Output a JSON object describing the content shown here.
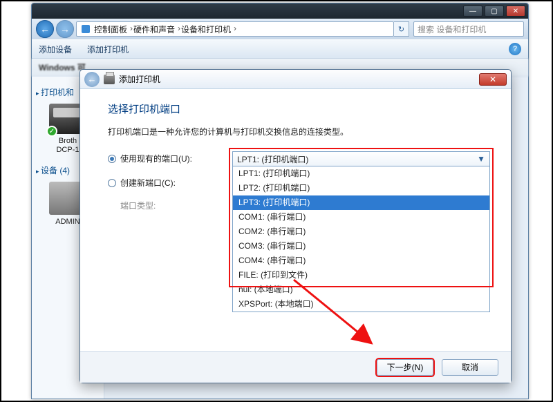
{
  "explorer": {
    "breadcrumb": [
      "控制面板",
      "硬件和声音",
      "设备和打印机"
    ],
    "search_placeholder": "搜索 设备和打印机",
    "toolbar": {
      "add_device": "添加设备",
      "add_printer": "添加打印机"
    },
    "info_prefix": "Windows 可",
    "sidebar": {
      "cat_printers": "打印机和",
      "device1_line1": "Broth",
      "device1_line2": "DCP-1",
      "cat_devices": "设备 (4)",
      "device2": "ADMIN"
    }
  },
  "dialog": {
    "title": "添加打印机",
    "heading": "选择打印机端口",
    "description": "打印机端口是一种允许您的计算机与打印机交换信息的连接类型。",
    "opt_use_existing": "使用现有的端口(U):",
    "opt_create_new": "创建新端口(C):",
    "port_type_label": "端口类型:",
    "combo_selected": "LPT1: (打印机端口)",
    "port_options": [
      "LPT1: (打印机端口)",
      "LPT2: (打印机端口)",
      "LPT3: (打印机端口)",
      "COM1: (串行端口)",
      "COM2: (串行端口)",
      "COM3: (串行端口)",
      "COM4: (串行端口)",
      "FILE: (打印到文件)",
      "nul: (本地端口)",
      "XPSPort: (本地端口)"
    ],
    "highlighted_index": 2,
    "buttons": {
      "next": "下一步(N)",
      "cancel": "取消"
    }
  }
}
